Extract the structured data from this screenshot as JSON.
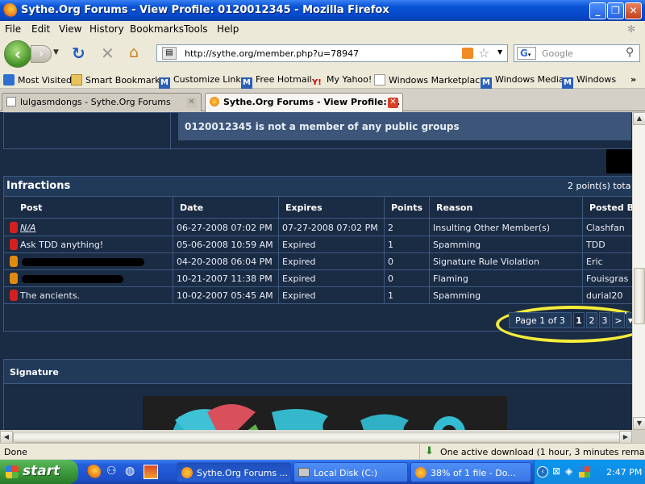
{
  "window": {
    "title": "Sythe.Org Forums - View Profile: 0120012345 - Mozilla Firefox"
  },
  "menu": [
    "File",
    "Edit",
    "View",
    "History",
    "Bookmarks",
    "Tools",
    "Help"
  ],
  "nav": {
    "url": "http://sythe.org/member.php?u=78947",
    "search_placeholder": "Google"
  },
  "bookmarks": [
    "Most Visited",
    "Smart Bookmarks",
    "Customize Links",
    "Free Hotmail",
    "My Yahoo!",
    "Windows Marketplace",
    "Windows Media",
    "Windows"
  ],
  "tabs": [
    {
      "label": "lulgasmdongs - Sythe.Org Forums"
    },
    {
      "label": "Sythe.Org Forums - View Profile: ..."
    }
  ],
  "page": {
    "groups_text": "0120012345 is not a member of any public groups",
    "infractions": {
      "title": "Infractions",
      "points_total": "2 point(s) tota",
      "columns": [
        "Post",
        "Date",
        "Expires",
        "Points",
        "Reason",
        "Posted B"
      ],
      "rows": [
        {
          "post": "N/A",
          "date": "06-27-2008 07:02 PM",
          "expires": "07-27-2008 07:02 PM",
          "points": "2",
          "reason": "Insulting Other Member(s)",
          "posted_by": "Clashfan",
          "status_color": "#d42020"
        },
        {
          "post": "Ask TDD anything!",
          "date": "05-06-2008 10:59 AM",
          "expires": "Expired",
          "points": "1",
          "reason": "Spamming",
          "posted_by": "TDD",
          "status_color": "#d42020"
        },
        {
          "post": "",
          "date": "04-20-2008 06:04 PM",
          "expires": "Expired",
          "points": "0",
          "reason": "Signature Rule Violation",
          "posted_by": "Eric",
          "status_color": "#e08a10"
        },
        {
          "post": "",
          "date": "10-21-2007 11:38 PM",
          "expires": "Expired",
          "points": "0",
          "reason": "Flaming",
          "posted_by": "Fouisgras",
          "status_color": "#e08a10"
        },
        {
          "post": "The ancients.",
          "date": "10-02-2007 05:45 AM",
          "expires": "Expired",
          "points": "1",
          "reason": "Spamming",
          "posted_by": "durial20",
          "status_color": "#d42020"
        }
      ],
      "pagination": {
        "label": "Page 1 of 3",
        "pages": [
          "1",
          "2",
          "3"
        ],
        "next": ">",
        "current": "1"
      }
    },
    "signature_title": "Signature"
  },
  "status": {
    "left": "Done",
    "download": "One active download (1 hour, 3 minutes remaining)"
  },
  "taskbar": {
    "start": "start",
    "tasks": [
      "Sythe.Org Forums ...",
      "Local Disk (C:)",
      "38% of 1 file - Do..."
    ],
    "clock": "2:47 PM"
  }
}
